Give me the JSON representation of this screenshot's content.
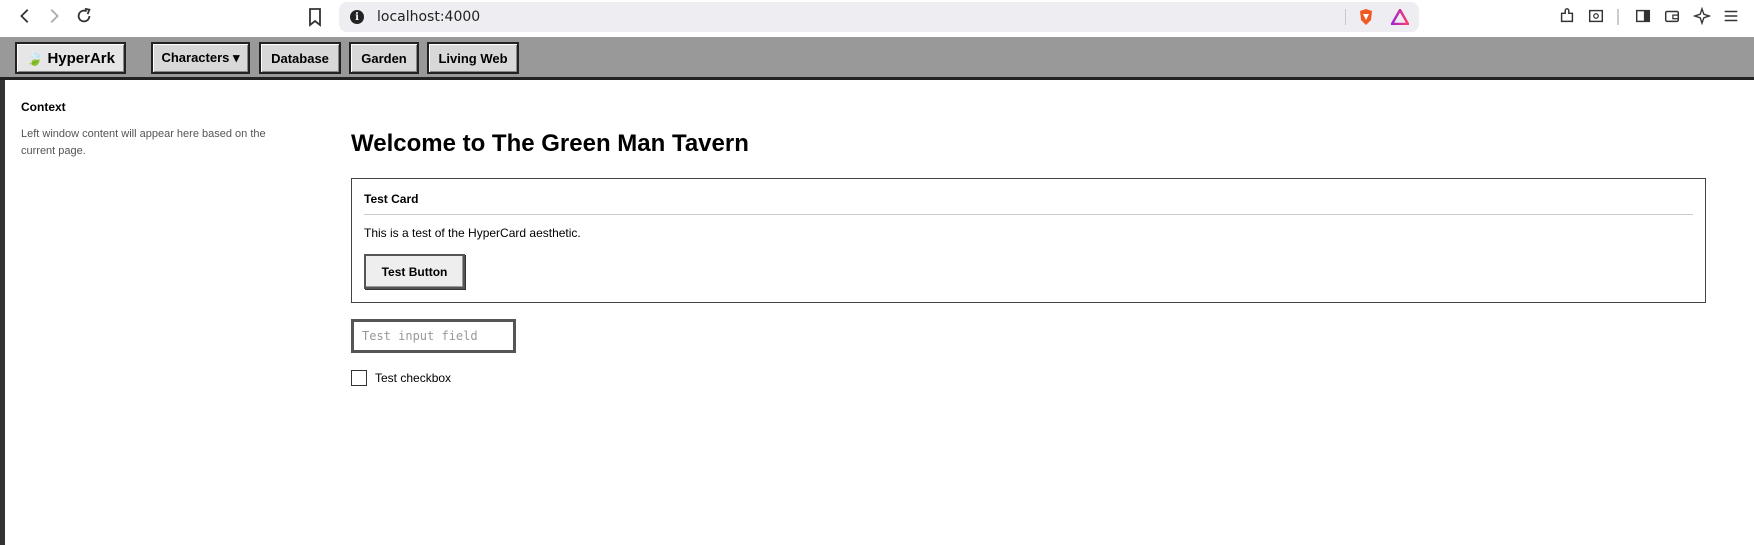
{
  "browser": {
    "url": "localhost:4000"
  },
  "toolbar": {
    "brand_icon": "leaf-icon",
    "brand_label": "HyperArk",
    "items": [
      {
        "label": "Characters ▾"
      },
      {
        "label": "Database"
      },
      {
        "label": "Garden"
      },
      {
        "label": "Living Web"
      }
    ]
  },
  "sidebar": {
    "title": "Context",
    "description": "Left window content will appear here based on the current page."
  },
  "main": {
    "title": "Welcome to The Green Man Tavern",
    "card": {
      "title": "Test Card",
      "body": "This is a test of the HyperCard aesthetic.",
      "button_label": "Test Button"
    },
    "input": {
      "placeholder": "Test input field",
      "value": ""
    },
    "checkbox": {
      "label": "Test checkbox",
      "checked": false
    }
  }
}
